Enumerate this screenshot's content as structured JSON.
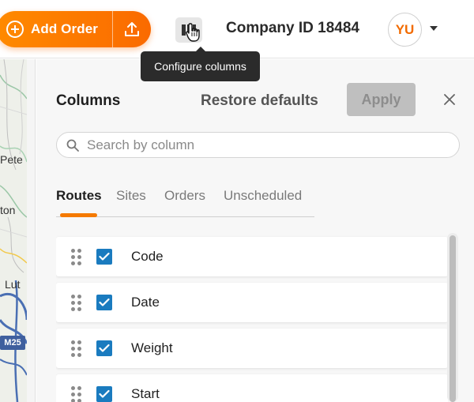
{
  "toolbar": {
    "add_order_label": "Add Order",
    "upload_icon": "upload-icon",
    "configure_icon": "columns-icon",
    "tooltip": "Configure columns",
    "company": "Company ID 18484",
    "avatar_initials": "YU",
    "accent_color": "#fa6a00"
  },
  "map": {
    "labels": [
      "Pete",
      "ton",
      "Lut"
    ],
    "shield": "M25"
  },
  "panel": {
    "title": "Columns",
    "restore_label": "Restore defaults",
    "apply_label": "Apply",
    "search_placeholder": "Search by column",
    "tabs": [
      {
        "label": "Routes",
        "active": true
      },
      {
        "label": "Sites",
        "active": false
      },
      {
        "label": "Orders",
        "active": false
      },
      {
        "label": "Unscheduled",
        "active": false
      }
    ],
    "columns": [
      {
        "label": "Code",
        "checked": true
      },
      {
        "label": "Date",
        "checked": true
      },
      {
        "label": "Weight",
        "checked": true
      },
      {
        "label": "Start",
        "checked": true
      }
    ],
    "checkbox_color": "#1a7bbf"
  }
}
